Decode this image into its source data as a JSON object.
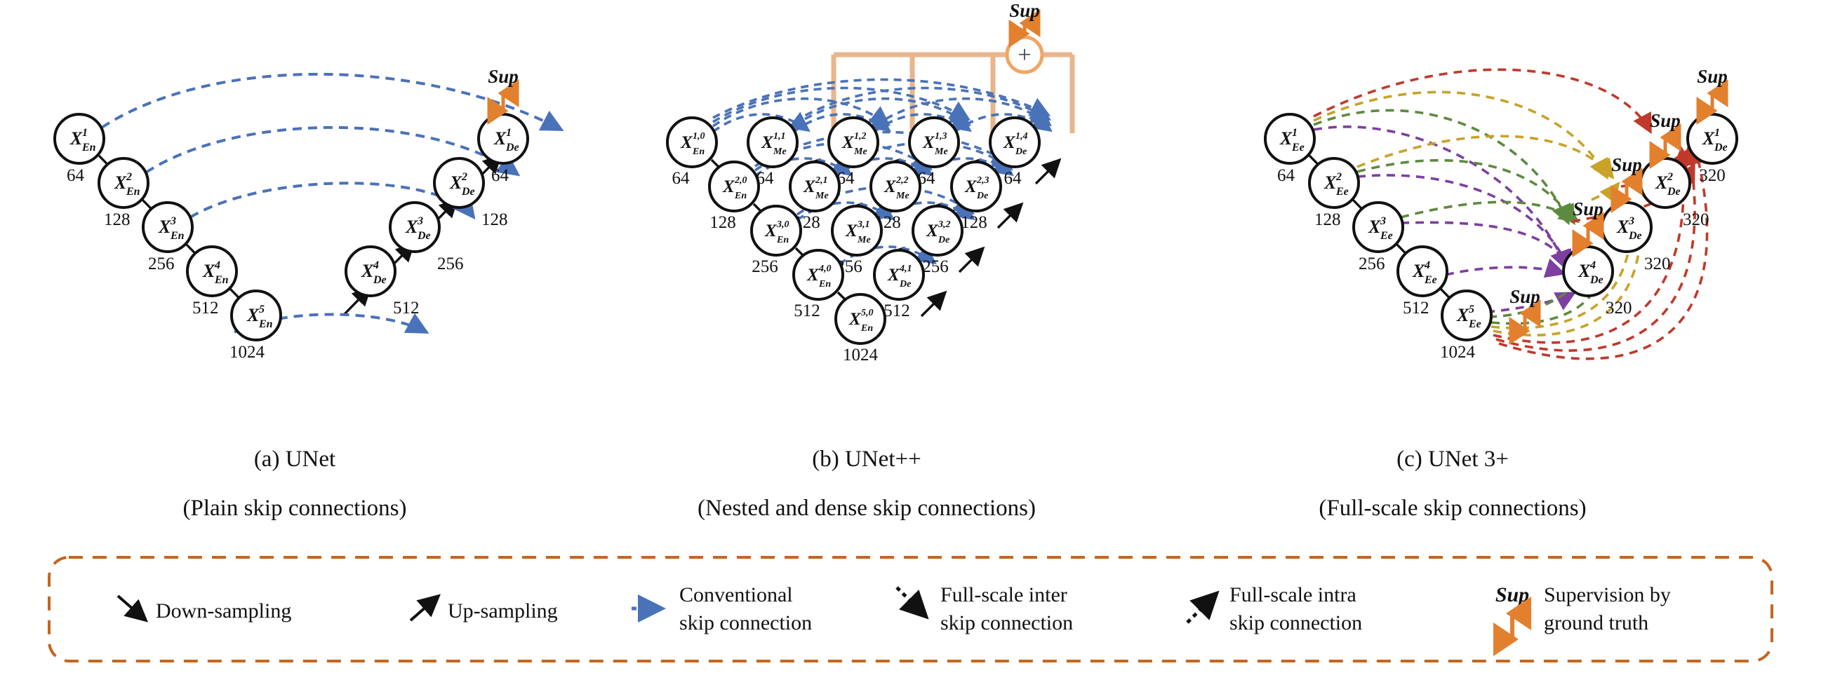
{
  "figure": {
    "panels": [
      {
        "id": "a",
        "caption_line1": "(a) UNet",
        "caption_line2": "(Plain skip connections)",
        "nodes": [
          {
            "name": "X-En-1",
            "base": "X",
            "sup": "1",
            "sub": "En",
            "channels": "64"
          },
          {
            "name": "X-En-2",
            "base": "X",
            "sup": "2",
            "sub": "En",
            "channels": "128"
          },
          {
            "name": "X-En-3",
            "base": "X",
            "sup": "3",
            "sub": "En",
            "channels": "256"
          },
          {
            "name": "X-En-4",
            "base": "X",
            "sup": "4",
            "sub": "En",
            "channels": "512"
          },
          {
            "name": "X-En-5",
            "base": "X",
            "sup": "5",
            "sub": "En",
            "channels": "1024"
          },
          {
            "name": "X-De-4",
            "base": "X",
            "sup": "4",
            "sub": "De",
            "channels": "512"
          },
          {
            "name": "X-De-3",
            "base": "X",
            "sup": "3",
            "sub": "De",
            "channels": "256"
          },
          {
            "name": "X-De-2",
            "base": "X",
            "sup": "2",
            "sub": "De",
            "channels": "128"
          },
          {
            "name": "X-De-1",
            "base": "X",
            "sup": "1",
            "sub": "De",
            "channels": "64"
          }
        ],
        "supervision": [
          "Sup"
        ]
      },
      {
        "id": "b",
        "caption_line1": "(b) UNet++",
        "caption_line2": "(Nested and dense skip connections)",
        "nodes": [
          {
            "name": "X-En-1-0",
            "base": "X",
            "sup": "1,0",
            "sub": "En",
            "channels": "64"
          },
          {
            "name": "X-Me-1-1",
            "base": "X",
            "sup": "1,1",
            "sub": "Me",
            "channels": "64"
          },
          {
            "name": "X-Me-1-2",
            "base": "X",
            "sup": "1,2",
            "sub": "Me",
            "channels": "64"
          },
          {
            "name": "X-Me-1-3",
            "base": "X",
            "sup": "1,3",
            "sub": "Me",
            "channels": "64"
          },
          {
            "name": "X-De-1-4",
            "base": "X",
            "sup": "1,4",
            "sub": "De",
            "channels": "64"
          },
          {
            "name": "X-En-2-0",
            "base": "X",
            "sup": "2,0",
            "sub": "En",
            "channels": "128"
          },
          {
            "name": "X-Me-2-1",
            "base": "X",
            "sup": "2,1",
            "sub": "Me",
            "channels": "128"
          },
          {
            "name": "X-Me-2-2",
            "base": "X",
            "sup": "2,2",
            "sub": "Me",
            "channels": "128"
          },
          {
            "name": "X-De-2-3",
            "base": "X",
            "sup": "2,3",
            "sub": "De",
            "channels": "128"
          },
          {
            "name": "X-En-3-0",
            "base": "X",
            "sup": "3,0",
            "sub": "En",
            "channels": "256"
          },
          {
            "name": "X-Me-3-1",
            "base": "X",
            "sup": "3,1",
            "sub": "Me",
            "channels": "256"
          },
          {
            "name": "X-De-3-2",
            "base": "X",
            "sup": "3,2",
            "sub": "De",
            "channels": "256"
          },
          {
            "name": "X-En-4-0",
            "base": "X",
            "sup": "4,0",
            "sub": "En",
            "channels": "512"
          },
          {
            "name": "X-De-4-1",
            "base": "X",
            "sup": "4,1",
            "sub": "De",
            "channels": "512"
          },
          {
            "name": "X-En-5-0",
            "base": "X",
            "sup": "5,0",
            "sub": "En",
            "channels": "1024"
          }
        ],
        "supervision": [
          "Sup"
        ],
        "aggregator_symbol": "+"
      },
      {
        "id": "c",
        "caption_line1": "(c) UNet 3+",
        "caption_line2": "(Full-scale skip connections)",
        "nodes": [
          {
            "name": "X-Ee-1",
            "base": "X",
            "sup": "1",
            "sub": "Ee",
            "channels": "64"
          },
          {
            "name": "X-Ee-2",
            "base": "X",
            "sup": "2",
            "sub": "Ee",
            "channels": "128"
          },
          {
            "name": "X-Ee-3",
            "base": "X",
            "sup": "3",
            "sub": "Ee",
            "channels": "256"
          },
          {
            "name": "X-Ee-4",
            "base": "X",
            "sup": "4",
            "sub": "Ee",
            "channels": "512"
          },
          {
            "name": "X-Ee-5",
            "base": "X",
            "sup": "5",
            "sub": "Ee",
            "channels": "1024"
          },
          {
            "name": "X-De-4",
            "base": "X",
            "sup": "4",
            "sub": "De",
            "channels": "320"
          },
          {
            "name": "X-De-3",
            "base": "X",
            "sup": "3",
            "sub": "De",
            "channels": "320"
          },
          {
            "name": "X-De-2",
            "base": "X",
            "sup": "2",
            "sub": "De",
            "channels": "320"
          },
          {
            "name": "X-De-1",
            "base": "X",
            "sup": "1",
            "sub": "De",
            "channels": "320"
          }
        ],
        "supervision": [
          "Sup",
          "Sup",
          "Sup",
          "Sup",
          "Sup"
        ]
      }
    ]
  },
  "legend": {
    "items": [
      {
        "key": "down-sampling",
        "label": "Down-sampling",
        "icon": "arrow-down-right",
        "color": "#111111"
      },
      {
        "key": "up-sampling",
        "label": "Up-sampling",
        "icon": "arrow-up-right",
        "color": "#111111"
      },
      {
        "key": "conventional-skip",
        "label_line1": "Conventional",
        "label_line2": "skip connection",
        "icon": "dotted-arrow-right",
        "color": "#4a72b8"
      },
      {
        "key": "full-scale-inter-skip",
        "label_line1": "Full-scale inter",
        "label_line2": "skip connection",
        "icon": "dotted-arrow-down-right",
        "color": "#111111"
      },
      {
        "key": "full-scale-intra-skip",
        "label_line1": "Full-scale intra",
        "label_line2": "skip connection",
        "icon": "dotted-arrow-up-right",
        "color": "#111111"
      },
      {
        "key": "supervision",
        "tag": "Sup",
        "label_line1": "Supervision by",
        "label_line2": "ground truth",
        "icon": "double-arrow-vertical",
        "color": "#e2802e"
      }
    ]
  },
  "colors": {
    "node_stroke": "#111111",
    "conventional_skip": "#4a72b8",
    "supervision_orange": "#e2802e",
    "aggregator_line": "#e8b58c",
    "legend_border": "#c4661f",
    "scale_red": "#c0392b",
    "scale_gold": "#c9a227",
    "scale_green": "#5d8a3f",
    "scale_purple": "#7d3fa0",
    "background": "#ffffff"
  }
}
